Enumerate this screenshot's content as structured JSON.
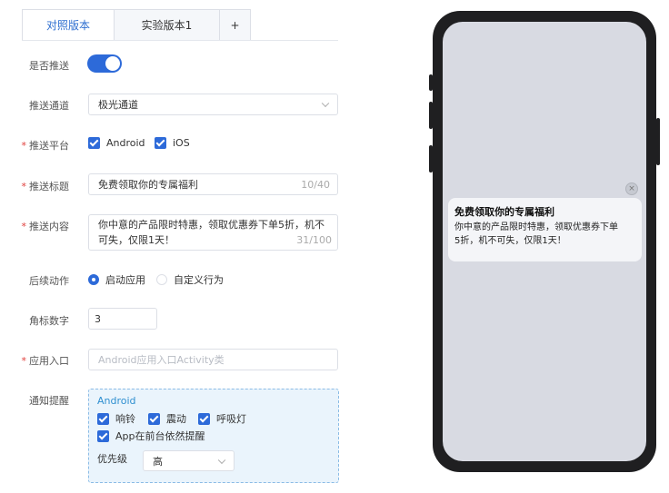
{
  "tabs": [
    {
      "label": "对照版本",
      "active": true
    },
    {
      "label": "实验版本1",
      "active": false
    },
    {
      "label": "+",
      "active": false
    }
  ],
  "form": {
    "push_enabled_label": "是否推送",
    "push_enabled": true,
    "channel_label": "推送通道",
    "channel_value": "极光通道",
    "platform_label": "推送平台",
    "platform_options": [
      {
        "label": "Android",
        "checked": true
      },
      {
        "label": "iOS",
        "checked": true
      }
    ],
    "title_label": "推送标题",
    "title_value": "免费领取你的专属福利",
    "title_counter": "10/40",
    "content_label": "推送内容",
    "content_value": "你中意的产品限时特惠，领取优惠券下单5折，机不可失，仅限1天！",
    "content_counter": "31/100",
    "action_label": "后续动作",
    "action_options": [
      {
        "label": "启动应用",
        "selected": true
      },
      {
        "label": "自定义行为",
        "selected": false
      }
    ],
    "badge_label": "角标数字",
    "badge_value": "3",
    "entry_label": "应用入口",
    "entry_placeholder": "Android应用入口Activity类",
    "reminder_label": "通知提醒",
    "reminder": {
      "platform": "Android",
      "options": [
        {
          "label": "响铃",
          "checked": true
        },
        {
          "label": "震动",
          "checked": true
        },
        {
          "label": "呼吸灯",
          "checked": true
        },
        {
          "label": "App在前台依然提醒",
          "checked": true
        }
      ],
      "priority_label": "优先级",
      "priority_value": "高"
    }
  },
  "preview": {
    "title": "免费领取你的专属福利",
    "line1": "你中意的产品限时特惠，领取优惠券下单",
    "line2": "5折，机不可失，仅限1天！",
    "close_glyph": "×"
  },
  "colors": {
    "accent": "#2d6ad9",
    "required": "#e0403c",
    "phone_body": "#1f1f21",
    "phone_screen": "#d8dae2"
  }
}
